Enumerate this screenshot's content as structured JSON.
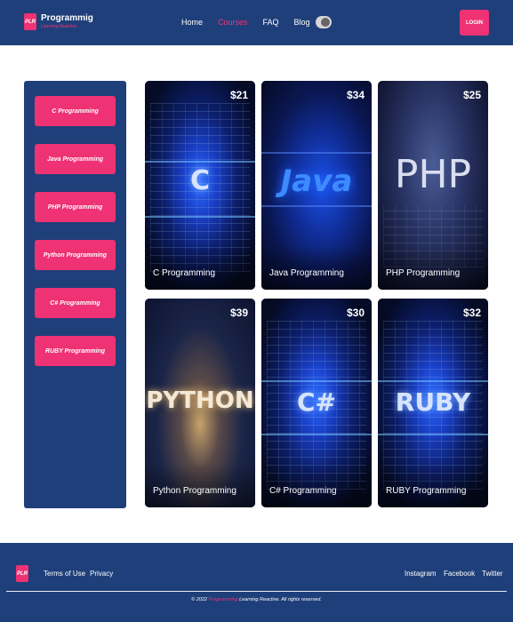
{
  "header": {
    "logo_text": "PLR",
    "brand_name": "Programmig",
    "brand_tagline": "Learning Reactive",
    "nav": [
      "Home",
      "Courses",
      "FAQ",
      "Blog"
    ],
    "active_nav": "Courses",
    "login_label": "LOGIN",
    "accent_color": "#ee3273",
    "primary_color": "#1f3f7a"
  },
  "sidebar": {
    "items": [
      {
        "label": "C Programming"
      },
      {
        "label": "Java Programming"
      },
      {
        "label": "PHP Programming"
      },
      {
        "label": "Python Programming"
      },
      {
        "label": "C# Programming"
      },
      {
        "label": "RUBY Programming"
      }
    ]
  },
  "courses": [
    {
      "title": "C Programming",
      "price": "$21",
      "art_text": "C"
    },
    {
      "title": "Java Programming",
      "price": "$34",
      "art_text": "Java"
    },
    {
      "title": "PHP Programming",
      "price": "$25",
      "art_text": "PHP"
    },
    {
      "title": "Python Programming",
      "price": "$39",
      "art_text": "PYTHON"
    },
    {
      "title": "C# Programming",
      "price": "$30",
      "art_text": "C#"
    },
    {
      "title": "RUBY Programming",
      "price": "$32",
      "art_text": "RUBY"
    }
  ],
  "footer": {
    "logo_text": "PLR",
    "links_left": [
      "Terms of Use",
      "Privacy"
    ],
    "links_right": [
      "Instagram",
      "Facebook",
      "Twitter"
    ],
    "copyright_prefix": "© 2022",
    "copyright_brand": "Programming",
    "copyright_suffix": "Learning Reactive. All rights reserved."
  }
}
